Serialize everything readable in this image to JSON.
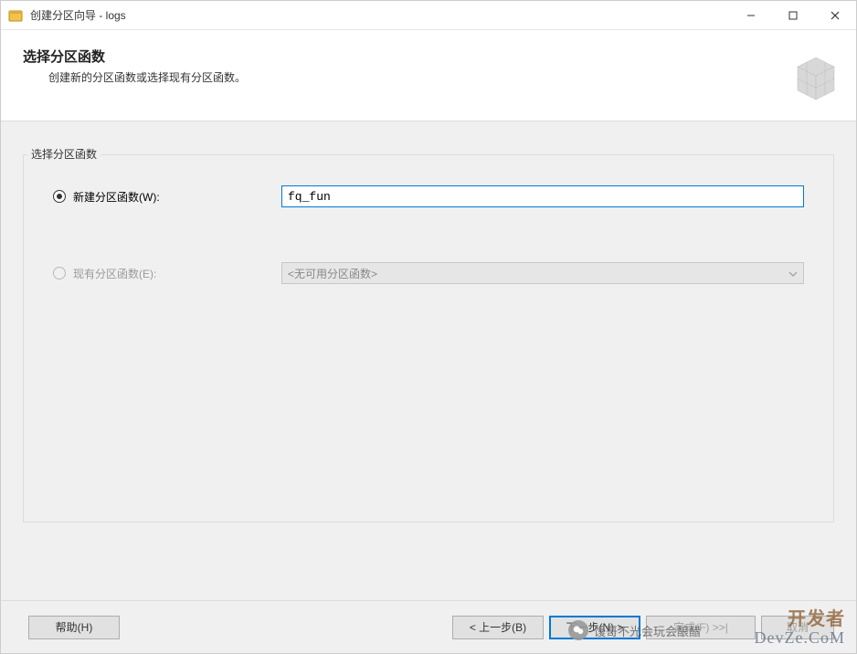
{
  "window": {
    "title": "创建分区向导 - logs"
  },
  "header": {
    "title": "选择分区函数",
    "subtitle": "创建新的分区函数或选择现有分区函数。"
  },
  "group": {
    "label": "选择分区函数",
    "new_option": {
      "label": "新建分区函数(W):",
      "value": "fq_fun",
      "selected": true
    },
    "existing_option": {
      "label": "现有分区函数(E):",
      "placeholder": "<无可用分区函数>",
      "enabled": false
    }
  },
  "footer": {
    "help": "帮助(H)",
    "back": "< 上一步(B)",
    "next": "下一步(N) >",
    "finish": "完成(F) >>|",
    "cancel": "取消"
  },
  "overlay": {
    "wechat_text": "馒哥不光会玩会酿醋",
    "brand_line1": "开发者",
    "brand_line2": "DevZe.CoM"
  }
}
